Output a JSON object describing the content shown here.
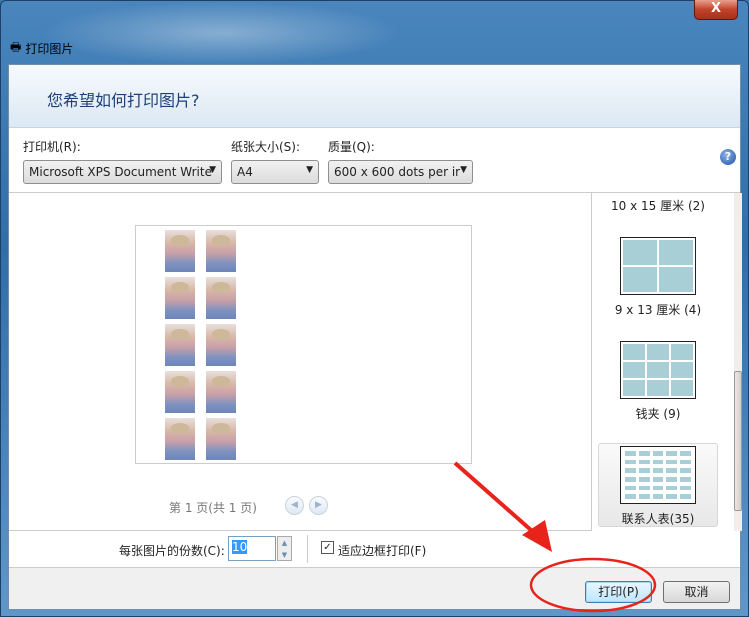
{
  "window": {
    "title": "打印图片",
    "close_label": "X"
  },
  "header": {
    "heading": "您希望如何打印图片?"
  },
  "options": {
    "printer_label": "打印机(R):",
    "printer_value": "Microsoft XPS Document Write",
    "paper_label": "纸张大小(S):",
    "paper_value": "A4",
    "quality_label": "质量(Q):",
    "quality_value": "600 x 600 dots per ir",
    "help_label": "?"
  },
  "preview": {
    "page_status": "第 1 页(共 1 页)",
    "prev": "◀",
    "next": "▶"
  },
  "layouts": [
    {
      "label": "10 x 15 厘米 (2)"
    },
    {
      "label": "9 x 13 厘米 (4)"
    },
    {
      "label": "钱夹 (9)"
    },
    {
      "label": "联系人表(35)",
      "selected": true
    }
  ],
  "bottom": {
    "copies_label": "每张图片的份数(C):",
    "copies_value": "10",
    "fit_label": "适应边框打印(F)",
    "fit_checked": true
  },
  "buttons": {
    "print": "打印(P)",
    "cancel": "取消"
  },
  "colors": {
    "annotation": "#e8231b",
    "accent": "#1e3f78"
  }
}
